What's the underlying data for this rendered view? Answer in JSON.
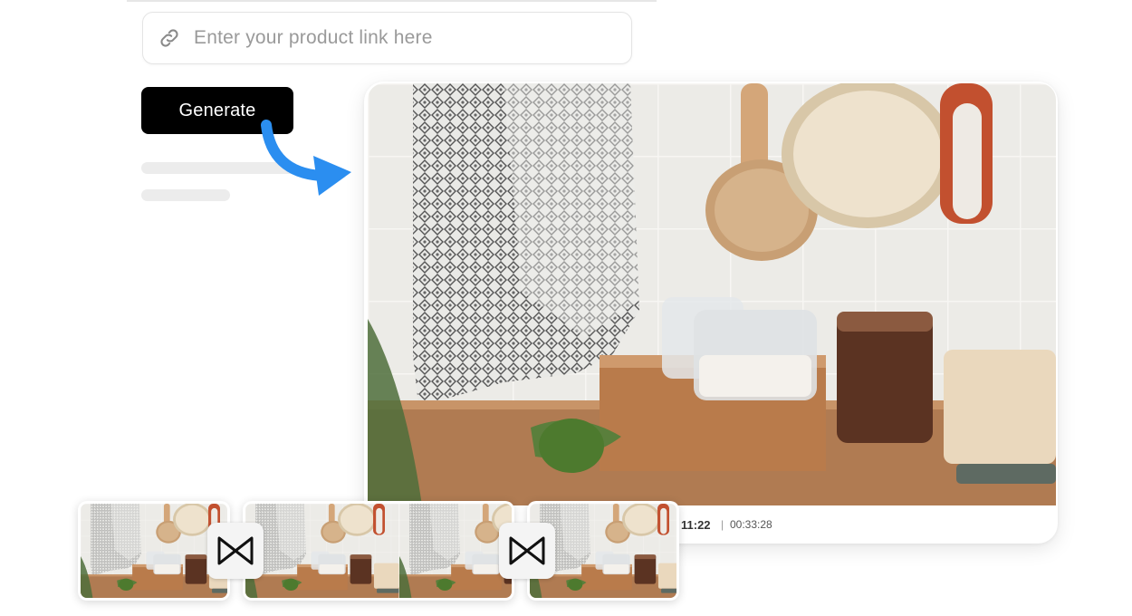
{
  "product_link": {
    "placeholder": "Enter your product link here",
    "icon": "link-icon"
  },
  "generate_button": {
    "label": "Generate"
  },
  "player": {
    "current_time": "11:22",
    "total_time": "00:33:28"
  },
  "timeline": {
    "clips": [
      "clip-1",
      "clip-2",
      "clip-3"
    ],
    "transitions": [
      "transition-icon",
      "transition-icon"
    ]
  },
  "colors": {
    "button_bg": "#000000",
    "arrow": "#2b8ef0",
    "box_wood": "#b97b4b",
    "candle": "#5b3322"
  }
}
